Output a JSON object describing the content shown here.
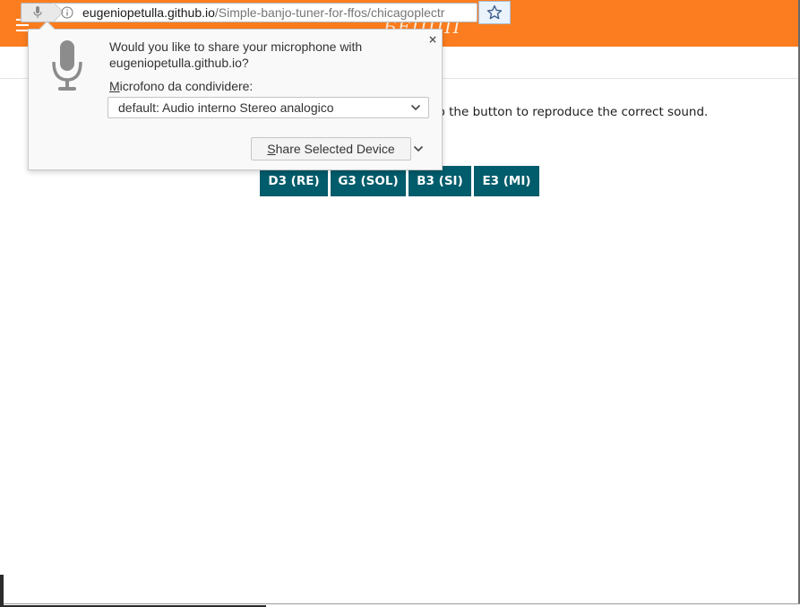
{
  "browser": {
    "url_host": "eugeniopetulla.github.io",
    "url_path": "/Simple-banjo-tuner-for-ffos/chicagoplectr",
    "icons": {
      "mic_chip": "microphone-icon",
      "info": "info-icon",
      "bookmark": "star-icon"
    }
  },
  "header": {
    "title": "БЕППП",
    "color": "#fb7d1f",
    "menu_icon": "hamburger-menu-icon"
  },
  "main": {
    "instructions": "ap the button to reproduce the correct sound.",
    "note_button_color": "#015c6b",
    "notes": [
      {
        "label": "D3 (RE)"
      },
      {
        "label": "G3 (SOL)"
      },
      {
        "label": "B3 (SI)"
      },
      {
        "label": "E3 (MI)"
      }
    ]
  },
  "permission_popup": {
    "icon": "microphone-icon",
    "question": "Would you like to share your microphone with eugeniopetulla.github.io?",
    "device_label_first": "M",
    "device_label_rest": "icrofono da condividere:",
    "device_selected": "default: Audio interno Stereo analogico",
    "share_button_first": "S",
    "share_button_rest": "hare Selected Device",
    "close_label": "×"
  }
}
